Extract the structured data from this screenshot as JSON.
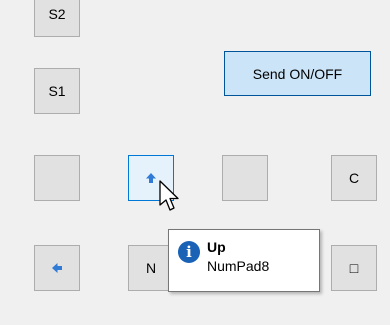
{
  "keypad": {
    "row0": {
      "s2_label": "S2"
    },
    "row1": {
      "s1_label": "S1",
      "send_label": "Send ON/OFF"
    },
    "row2": {
      "blank1_label": "",
      "up_icon": "up-arrow-icon",
      "blank2_label": "",
      "c_label": "C"
    },
    "row3": {
      "left_icon": "left-arrow-icon",
      "n_label": "N",
      "blank3_label": "",
      "square_label": "□"
    }
  },
  "tooltip": {
    "icon": "info-icon",
    "icon_glyph": "i",
    "title": "Up",
    "subtitle": "NumPad8"
  },
  "colors": {
    "arrow": "#2f7bd6",
    "hover_border": "#0078d7",
    "send_bg": "#cce4f7",
    "tooltip_icon": "#1a62b6"
  }
}
